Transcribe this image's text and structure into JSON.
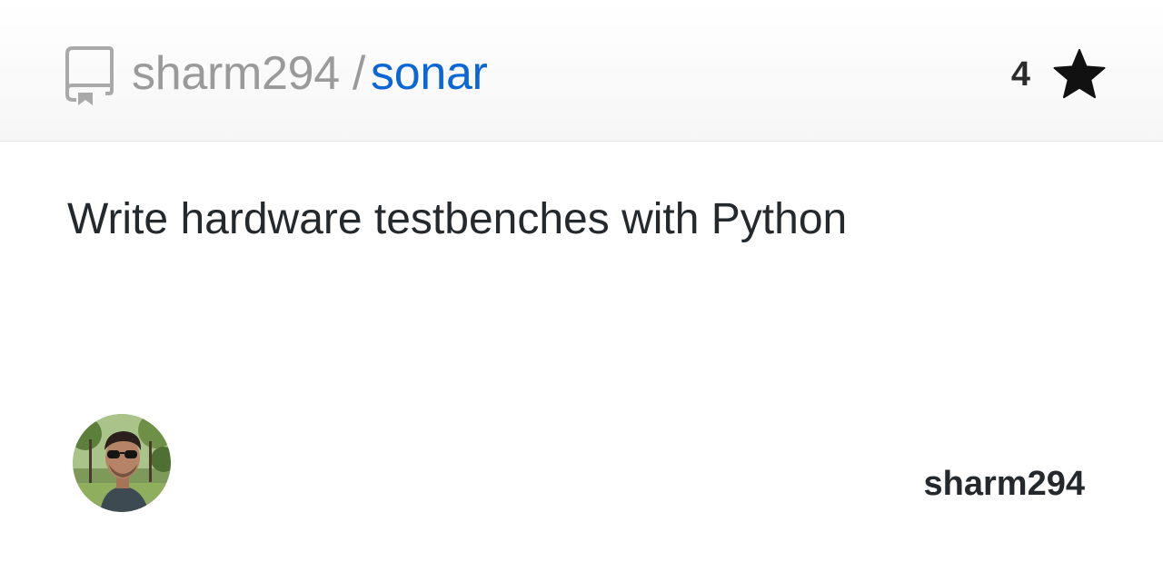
{
  "header": {
    "owner": "sharm294",
    "separator": "/",
    "repo": "sonar",
    "star_count": "4",
    "repo_icon": "repo-icon",
    "star_icon": "star-icon"
  },
  "description": "Write hardware testbenches with Python",
  "footer": {
    "avatar_icon": "user-avatar",
    "author": "sharm294"
  },
  "colors": {
    "owner_text": "#9a9a9a",
    "repo_link": "#0b66d6",
    "body_text": "#24292e"
  }
}
